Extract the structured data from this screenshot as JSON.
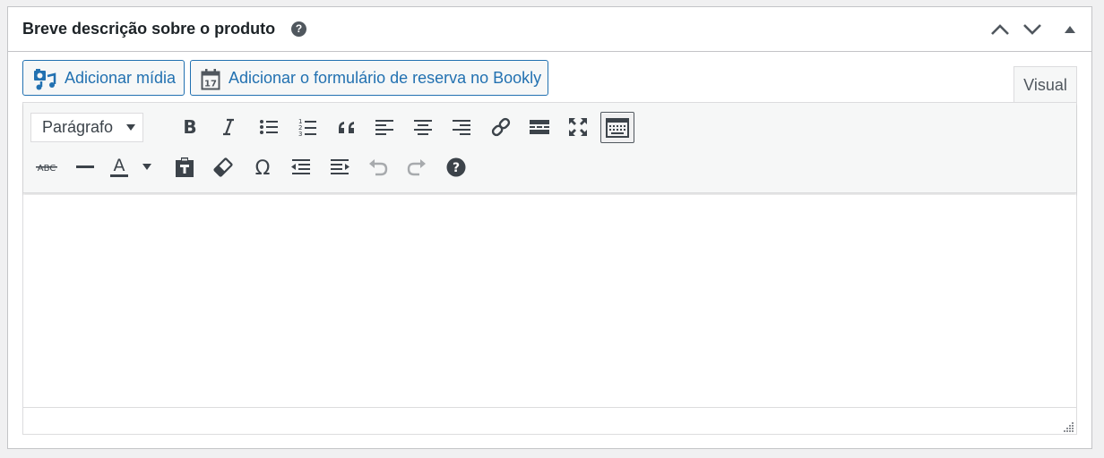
{
  "panel": {
    "title": "Breve descrição sobre o produto",
    "help_symbol": "?",
    "controls": [
      "move-up-icon",
      "move-down-icon",
      "toggle-panel-icon"
    ]
  },
  "media_buttons": {
    "add_media": "Adicionar mídia",
    "add_booking_form": "Adicionar o formulário de reserva no Bookly"
  },
  "tabs": {
    "visual": "Visual"
  },
  "toolbar": {
    "format_select": "Parágrafo",
    "row1": [
      "bold-icon",
      "italic-icon",
      "bulleted-list-icon",
      "numbered-list-icon",
      "blockquote-icon",
      "align-left-icon",
      "align-center-icon",
      "align-right-icon",
      "link-icon",
      "read-more-icon",
      "fullscreen-icon",
      "toolbar-toggle-icon"
    ],
    "row2": [
      "strikethrough-icon",
      "horizontal-line-icon",
      "text-color-icon",
      "paste-as-text-icon",
      "clear-formatting-icon",
      "special-character-icon",
      "outdent-icon",
      "indent-icon",
      "undo-icon",
      "redo-icon",
      "keyboard-help-icon"
    ]
  },
  "colors": {
    "accent": "#2271b1",
    "icon": "#3c434a",
    "icon_disabled": "#a7aaad",
    "border": "#c3c4c7",
    "toolbar_bg": "#f6f7f7"
  }
}
